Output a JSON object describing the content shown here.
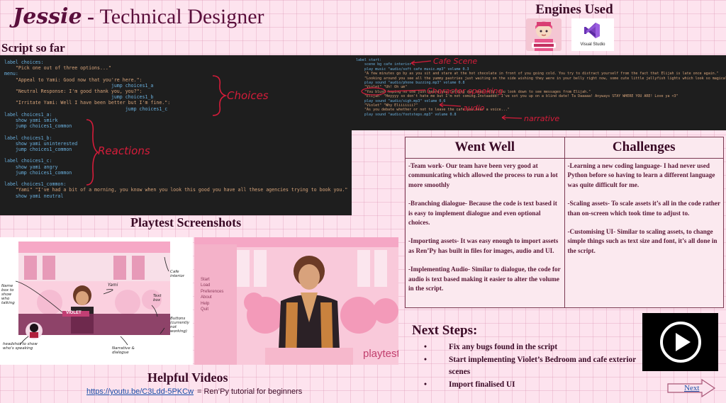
{
  "header": {
    "name": "Jessie",
    "dash": " - ",
    "role": "Technical Designer"
  },
  "engines": {
    "title": "Engines Used",
    "vs_caption": "Visual Studio"
  },
  "script_section": {
    "title": "Script so far"
  },
  "code_left": {
    "lines": [
      "label choices:",
      "    \"Pick one out of three options...\"",
      "menu:",
      "    \"Appeal to Yami: Good now that you're here.\":",
      "                                      jump choices1_a",
      "    \"Neutral Response: I'm good thank you, you?\":",
      "                                      jump choices1_b",
      "    \"Irritate Yami: Well I have been better but I'm fine.\":",
      "                                           jump choices1_c",
      "label choices1_a:",
      "    show yami smirk",
      "    jump choices1_common",
      "",
      "label choices1_b:",
      "    show yami uninterested",
      "    jump choices1_common",
      "",
      "label choices1_c:",
      "    show yami angry",
      "    jump choices1_common",
      "",
      "label choices1_common:",
      "    \"Yami\" \"I've had a bit of a morning, you know when you look this good you have all these agencies trying to book you.\"",
      "    show yami neutral"
    ],
    "annotations": {
      "choices": "Choices",
      "reactions": "Reactions"
    }
  },
  "code_right": {
    "lines": [
      "label start:",
      "    scene bg cafe interior",
      "    play music \"audio/soft cafe music.mp3\" volume 0.3",
      "    \"A few minutes go by as you sit and stare at the hot chocolate in front of you going cold. You try to distract yourself from the fact that Elijah is late once again.\"",
      "    \"Looking around you see all the yummy pastries just waiting on the side wishing they were in your belly right now, some cute little jellyfish lights which look so magical and...\"",
      "    play sound \"audio/phone buzzing.mp3\" volume 0.8",
      "    \"Violet\" \"Uh! Oh um\"",
      "    \"You blush hoping no one just heard you letting out that yelp. You look down to see messages from Elijah.\"",
      "    \"Elijah\" \"Heyyyy so don't hate me but I'm not coming.Instaaddd! I've sot you up on a blind date! Ta Daaaaa! Anyways STAY WHERE YOU ARE! Love ya <3\"",
      "    play sound \"audio/sigh.mp3\" volume 0.6",
      "    \"Violet\" \"Why Eliiiiiii?\"",
      "    \"As you debate whether or not to leave the cafe you hear a voice...\"",
      "    play sound \"audio/footsteps.mp3\" volume 0.8"
    ],
    "annotations": {
      "cafe": "Cafe Scene",
      "character": "Character speaking",
      "audio": "audio",
      "narrative": "narrative"
    }
  },
  "table": {
    "went_well": {
      "title": "Went Well",
      "items": [
        "-Team work- Our team have been very good at communicating which allowed the process to run a lot more smoothly",
        "-Branching dialogue- Because the code is text based it is easy to implement dialogue and even optional choices.",
        "-Importing assets- It was easy enough to import assets as Ren’Py has built in files for images, audio and UI.",
        "-Implementing Audio- Similar to dialogue, the code for audio is text based making it easier to alter the volume in the script."
      ]
    },
    "challenges": {
      "title": "Challenges",
      "items": [
        "-Learning a new coding language- I had never used Python before so having to learn a different language was quite difficult for me.",
        "-Scaling assets- To scale assets it’s all in the code rather than on-screen which took time to adjust to.",
        "-Customising UI- Similar to scaling assets, to change simple things such as text size and font, it’s all done in the script."
      ]
    }
  },
  "playtest": {
    "title": "Playtest Screenshots",
    "left_notes": {
      "name_box": "Name box to show who talking",
      "violet": "VIOLET",
      "yami": "Yami",
      "cafe": "Cafe interior",
      "text_box": "Text box",
      "buttons": "Buttons (currently not working)",
      "headshot": "headshot to show who's speaking",
      "narrative": "Narrative & dialogue"
    },
    "menu_items": [
      "Start",
      "Load",
      "Preferences",
      "About",
      "Help",
      "Quit"
    ],
    "watermark": "playtest"
  },
  "videos": {
    "title": "Helpful Videos",
    "link": "https://youtu.be/C3Ldd-5PKCw",
    "desc": " = Ren’Py tutorial for beginners"
  },
  "next_steps": {
    "title": "Next Steps:",
    "items": [
      "Fix any bugs found in the script",
      "Start implementing Violet’s Bedroom and cafe exterior scenes",
      "Import finalised UI"
    ]
  },
  "nav": {
    "next_label": "Next"
  }
}
